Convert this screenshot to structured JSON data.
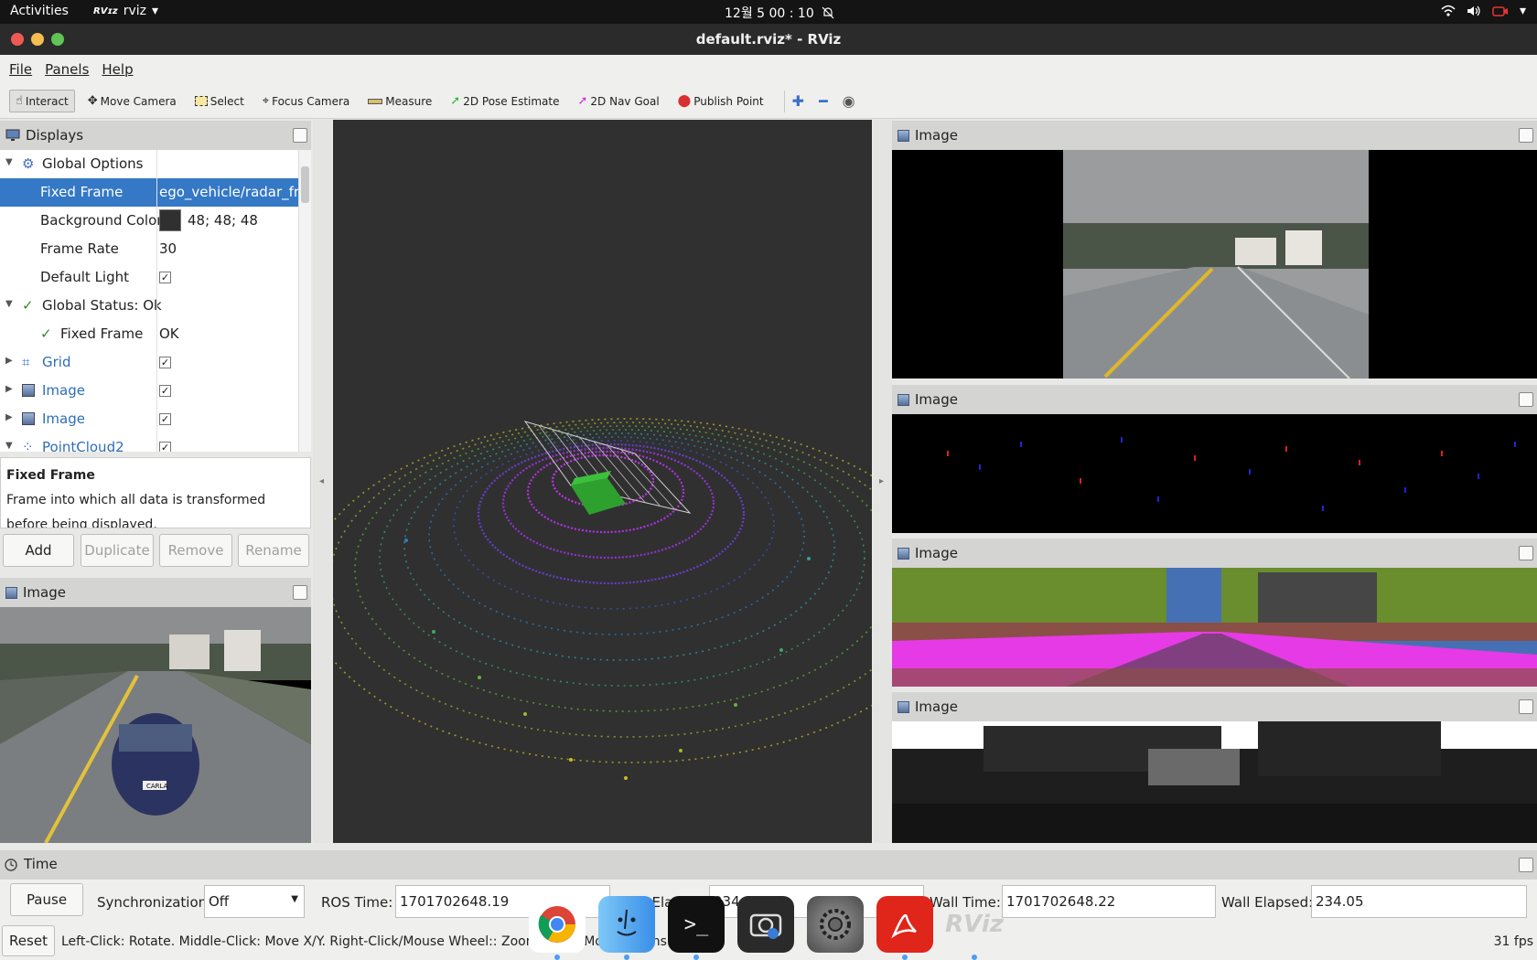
{
  "system": {
    "activities": "Activities",
    "app_name": "rviz",
    "app_logo_text": "RViz",
    "clock": "12월 5  00 : 10"
  },
  "window": {
    "title": "default.rviz* - RViz"
  },
  "menu": {
    "file": "File",
    "panels": "Panels",
    "help": "Help"
  },
  "toolbar": {
    "interact": "Interact",
    "move_camera": "Move Camera",
    "select": "Select",
    "focus_camera": "Focus Camera",
    "measure": "Measure",
    "pose_estimate": "2D Pose Estimate",
    "nav_goal": "2D Nav Goal",
    "publish_point": "Publish Point"
  },
  "displays": {
    "title": "Displays",
    "rows": {
      "global_options": "Global Options",
      "fixed_frame_key": "Fixed Frame",
      "fixed_frame_val": "ego_vehicle/radar_fr...",
      "bg_key": "Background Color",
      "bg_val": "48; 48; 48",
      "frame_rate_key": "Frame Rate",
      "frame_rate_val": "30",
      "default_light_key": "Default Light",
      "global_status": "Global Status: Ok",
      "status_fixed_frame": "Fixed Frame",
      "status_ok": "OK",
      "grid": "Grid",
      "image1": "Image",
      "image2": "Image",
      "pointcloud": "PointCloud2"
    },
    "description_title": "Fixed Frame",
    "description_text": "Frame into which all data is transformed before being displayed.",
    "buttons": {
      "add": "Add",
      "duplicate": "Duplicate",
      "remove": "Remove",
      "rename": "Rename"
    }
  },
  "left_image_panel": {
    "title": "Image",
    "plate": "CARLA"
  },
  "right_panels": [
    {
      "title": "Image"
    },
    {
      "title": "Image"
    },
    {
      "title": "Image"
    },
    {
      "title": "Image"
    }
  ],
  "time": {
    "title": "Time",
    "pause": "Pause",
    "sync_label": "Synchronization:",
    "sync_value": "Off",
    "ros_time_label": "ROS Time:",
    "ros_time": "1701702648.19",
    "ros_elapsed_label": "ROS Elapsed:",
    "ros_elapsed": "234.15",
    "wall_time_label": "Wall Time:",
    "wall_time": "1701702648.22",
    "wall_elapsed_label": "Wall Elapsed:",
    "wall_elapsed": "234.05",
    "reset": "Reset",
    "hint": "Left-Click: Rotate. Middle-Click: Move X/Y. Right-Click/Mouse Wheel:: Zoom. Shift: More options.",
    "fps": "31 fps"
  },
  "colors": {
    "selection": "#3478c6",
    "viewport_bg": "#303030",
    "pointcloud_near": "#cc33ff",
    "ego_box": "#2ea02e"
  },
  "dock": [
    "chrome-icon",
    "finder-icon",
    "terminal-icon",
    "screenshot-icon",
    "settings-icon",
    "acrobat-icon",
    "rviz-icon"
  ]
}
